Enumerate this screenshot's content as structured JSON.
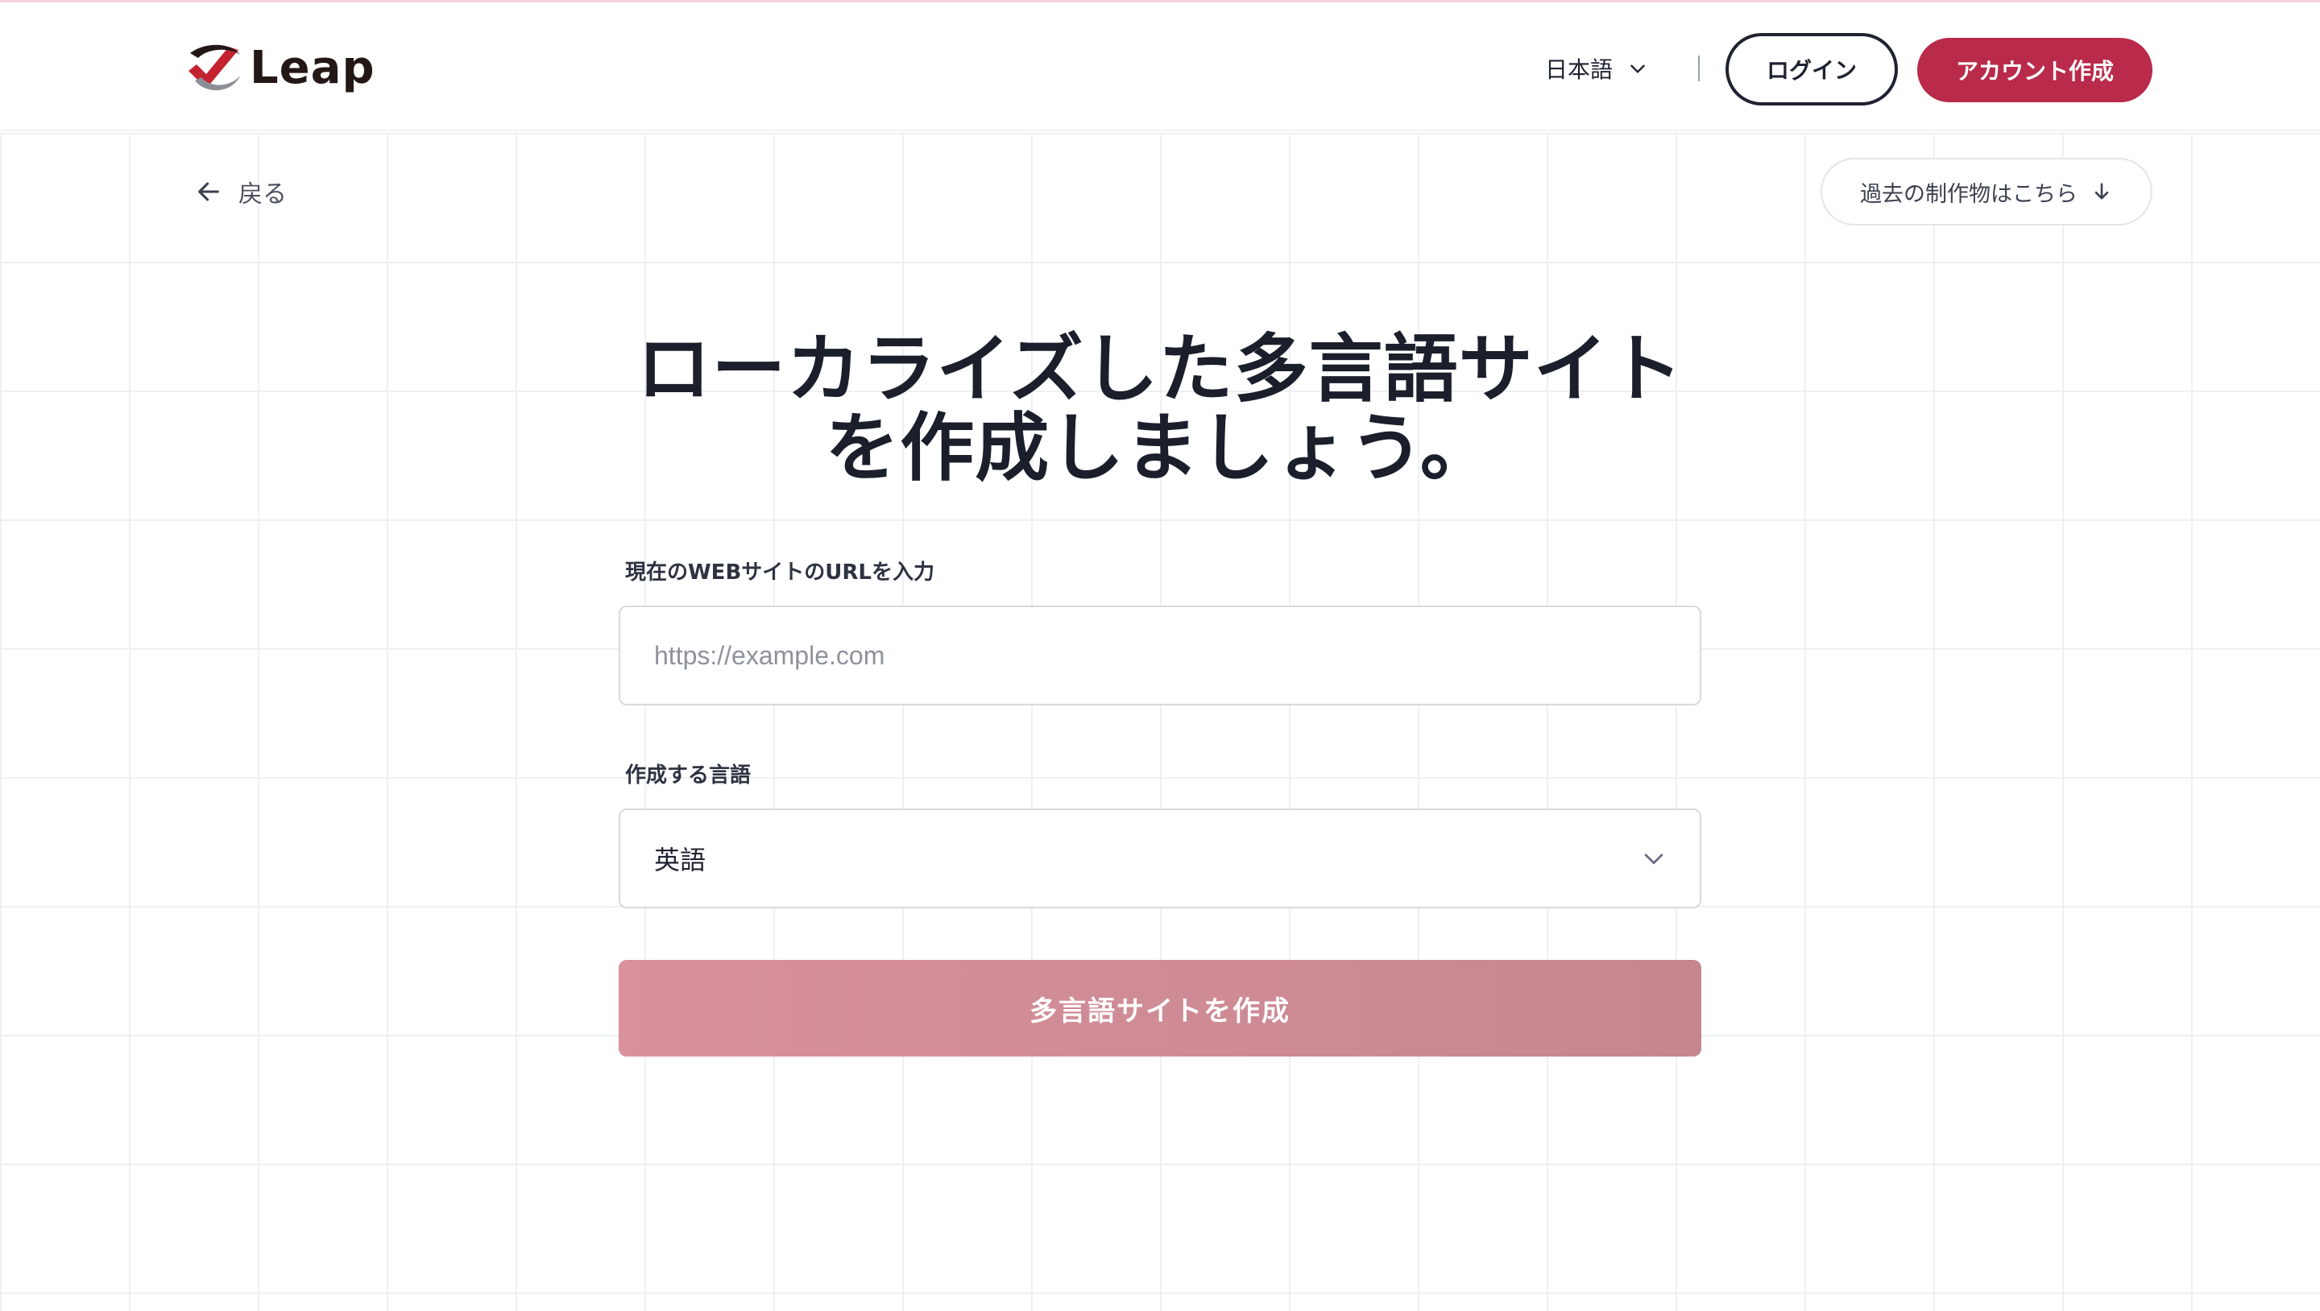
{
  "header": {
    "logo_text": "Leap",
    "language_label": "日本語",
    "login_label": "ログイン",
    "signup_label": "アカウント作成"
  },
  "nav": {
    "back_label": "戻る",
    "past_works_label": "過去の制作物はこちら"
  },
  "main": {
    "title_line1": "ローカライズした多言語サイト",
    "title_line2": "を作成しましょう。",
    "url_label": "現在のWEBサイトのURLを入力",
    "url_placeholder": "https://example.com",
    "url_value": "",
    "language_select_label": "作成する言語",
    "language_selected": "英語",
    "submit_label": "多言語サイトを作成"
  },
  "colors": {
    "brand": "#b92a4b",
    "submit_disabled": "#d28c96",
    "text_dark": "#1b1f2b"
  },
  "icons": {
    "logo": "leap-logo-icon",
    "language_chevron": "chevron-down-icon",
    "back": "arrow-left-icon",
    "past_works": "arrow-down-icon",
    "select_chevron": "chevron-down-icon"
  }
}
